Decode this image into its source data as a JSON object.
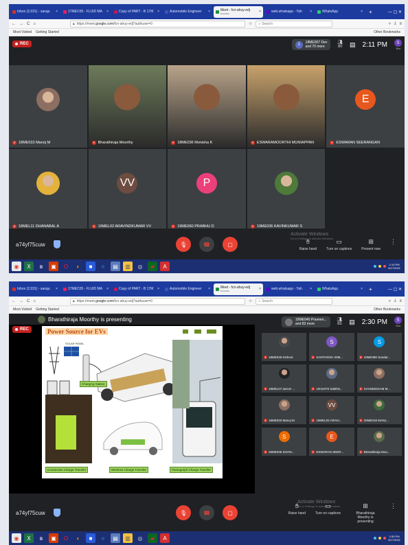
{
  "tabs": [
    {
      "label": "Inbox (2,031) - saraju",
      "color": "#d93025"
    },
    {
      "label": "17MEC05 - FLUID MA",
      "color": "#e91e63"
    },
    {
      "label": "Copy of PART - B 17M",
      "color": "#c2185b"
    },
    {
      "label": "Automobile Engineer",
      "color": "#3f51b5"
    },
    {
      "label": "Meet - fcn-ahuy-edj",
      "playing": "PLAYING",
      "color": "#1e8e3e"
    },
    {
      "label": "web.whatsapp - Yah",
      "color": "#6001d2"
    },
    {
      "label": "WhatsApp",
      "color": "#25d366"
    }
  ],
  "browser": {
    "url_prefix": "https://meet.",
    "url_domain": "google.com",
    "url_path": "/fcn-ahuy-edj?authuser=0",
    "search_placeholder": "Search",
    "bookmarks": [
      "Most Visited",
      "Getting Started"
    ],
    "other_bookmarks": "Other Bookmarks"
  },
  "shot1": {
    "rec": "REC",
    "presenting": {
      "initials": "1",
      "line1": "18ME007 Dev",
      "line2": "and 70 more"
    },
    "count": "80",
    "time": "2:11 PM",
    "you_initial": "S",
    "you_label": "You",
    "tiles": [
      {
        "name": "18ME033 Manoj M",
        "kind": "photo",
        "color": "#8d6e63"
      },
      {
        "name": "Bharathiraja Moorthy",
        "kind": "video",
        "color": "#6d7b5a"
      },
      {
        "name": "18ME036 Monisha K",
        "kind": "video",
        "color": "#b9a48a"
      },
      {
        "name": "ESWARAMOORTHI MUNIAPPAN",
        "kind": "video",
        "color": "#c8a26b"
      },
      {
        "name": "ESWARAN SEERANGAN",
        "kind": "avatar",
        "initial": "E",
        "color": "#e8571d"
      },
      {
        "name": "18MEL11 DHANABAL A",
        "kind": "photo",
        "color": "#e2b23a"
      },
      {
        "name": "19MEL02 ARAVINDKUMAR VV",
        "kind": "avatar",
        "initial": "VV",
        "color": "#6d4c41"
      },
      {
        "name": "19ME060 PRABHU D",
        "kind": "avatar",
        "initial": "P",
        "color": "#ec407a"
      },
      {
        "name": "19ME036 KAVINKUMAR S",
        "kind": "photo",
        "color": "#4e7a3a"
      }
    ],
    "code": "a74yf75cuw",
    "raise": "Raise hand",
    "captions": "Turn on captions",
    "present": "Present now",
    "watermark": "Activate Windows",
    "watermark_sub": "Go to Settings to activate Windows.",
    "clock_time": "2:10 PM",
    "clock_date": "5/17/2021"
  },
  "shot2": {
    "rec": "REC",
    "presenter_text": "Bharathiraja Moorthy is presenting",
    "presenting": {
      "line1": "18ME040 Praveen...",
      "line2": "and 83 more"
    },
    "count": "85",
    "time": "2:30 PM",
    "you_initial": "S",
    "you_label": "You",
    "slide": {
      "title": "Power Source for EVs",
      "solar": "SOLAR PANEL",
      "captions": [
        "Charging Station",
        "Conductive Charge Transfer",
        "Wireless Charge Transfer",
        "Pantograph Charge Transfer"
      ]
    },
    "tiles": [
      {
        "name": "18ME028 Kishore",
        "kind": "photo",
        "color": "#4a4a4a"
      },
      {
        "name": "SANTHOSH 20M...",
        "kind": "avatar",
        "initial": "S",
        "color": "#7e57c2"
      },
      {
        "name": "19ME080 Sundar...",
        "kind": "avatar",
        "initial": "S",
        "color": "#039be5"
      },
      {
        "name": "18MEL07 assvin ...",
        "kind": "photo",
        "color": "#222"
      },
      {
        "name": "19me070 Sakthiv...",
        "kind": "photo",
        "color": "#5f6b85"
      },
      {
        "name": "SHANMUGAM M...",
        "kind": "photo",
        "color": "#8d6e63"
      },
      {
        "name": "18ME033 Manoj M",
        "kind": "photo",
        "color": "#8d6e63"
      },
      {
        "name": "19MEL02 ARAVI...",
        "kind": "avatar",
        "initial": "VV",
        "color": "#6d4c41"
      },
      {
        "name": "20ME018 MANJ...",
        "kind": "photo",
        "color": "#3d6b3d"
      },
      {
        "name": "20ME036 SIVAN...",
        "kind": "avatar",
        "initial": "S",
        "color": "#ef6c00"
      },
      {
        "name": "ESWARAN SEER...",
        "kind": "avatar",
        "initial": "E",
        "color": "#e8571d"
      },
      {
        "name": "Bharathiraja Moo...",
        "kind": "photo",
        "color": "#5a6b4a"
      }
    ],
    "code": "a74yf75cuw",
    "raise": "Raise hand",
    "captions": "Turn on captions",
    "presenting_label": "Bharathiraja Moorthy is presenting",
    "watermark": "Activate Windows",
    "watermark_sub": "Go to Settings to activate Windows.",
    "clock_time": "2:30 PM",
    "clock_date": "5/17/2021"
  },
  "taskbar_apps": [
    {
      "icon": "chrome-icon",
      "color": "#e8eaed",
      "glyph": "◉",
      "gcolor": "#db4437"
    },
    {
      "icon": "excel-icon",
      "color": "#1e7145",
      "glyph": "X",
      "gcolor": "#fff"
    },
    {
      "icon": "bluetooth-icon",
      "color": "#1c2f73",
      "glyph": "ʙ",
      "gcolor": "#fff"
    },
    {
      "icon": "office-icon",
      "color": "#d83b01",
      "glyph": "▣",
      "gcolor": "#fff"
    },
    {
      "icon": "opera-icon",
      "color": "#1c2f73",
      "glyph": "O",
      "gcolor": "#ff1b2d"
    },
    {
      "icon": "firefox-icon",
      "color": "#1c2f73",
      "glyph": "◐",
      "gcolor": "#ff9500"
    },
    {
      "icon": "media-icon",
      "color": "#2a5bd7",
      "glyph": "■",
      "gcolor": "#fff"
    },
    {
      "icon": "edge-icon",
      "color": "#1c2f73",
      "glyph": "e",
      "gcolor": "#3277bc"
    },
    {
      "icon": "notes-icon",
      "color": "#5c7cba",
      "glyph": "▤",
      "gcolor": "#fff"
    },
    {
      "icon": "files-icon",
      "color": "#f5c242",
      "glyph": "▥",
      "gcolor": "#555"
    },
    {
      "icon": "settings-icon",
      "color": "#1c2f73",
      "glyph": "◎",
      "gcolor": "#ddd"
    },
    {
      "icon": "flag-icon",
      "color": "#0b6623",
      "glyph": "▰",
      "gcolor": "#d32f2f"
    },
    {
      "icon": "pdf-icon",
      "color": "#d32f2f",
      "glyph": "A",
      "gcolor": "#fff"
    }
  ]
}
